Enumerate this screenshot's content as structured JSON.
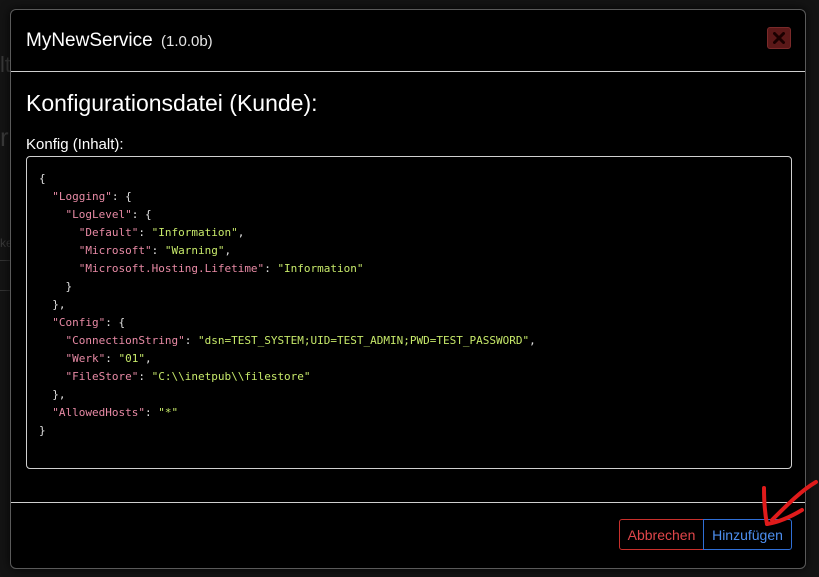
{
  "modal": {
    "title": "MyNewService",
    "version": "(1.0.0b)",
    "heading": "Konfigurationsdatei (Kunde):",
    "config_label": "Konfig (Inhalt):",
    "close_icon": "close-x-icon",
    "config_lines": [
      [
        {
          "t": "p",
          "v": "{"
        }
      ],
      [
        {
          "t": "p",
          "v": "  "
        },
        {
          "t": "k",
          "v": "\"Logging\""
        },
        {
          "t": "p",
          "v": ": {"
        }
      ],
      [
        {
          "t": "p",
          "v": "    "
        },
        {
          "t": "k",
          "v": "\"LogLevel\""
        },
        {
          "t": "p",
          "v": ": {"
        }
      ],
      [
        {
          "t": "p",
          "v": "      "
        },
        {
          "t": "k",
          "v": "\"Default\""
        },
        {
          "t": "p",
          "v": ": "
        },
        {
          "t": "s",
          "v": "\"Information\""
        },
        {
          "t": "p",
          "v": ","
        }
      ],
      [
        {
          "t": "p",
          "v": "      "
        },
        {
          "t": "k",
          "v": "\"Microsoft\""
        },
        {
          "t": "p",
          "v": ": "
        },
        {
          "t": "s",
          "v": "\"Warning\""
        },
        {
          "t": "p",
          "v": ","
        }
      ],
      [
        {
          "t": "p",
          "v": "      "
        },
        {
          "t": "k",
          "v": "\"Microsoft.Hosting.Lifetime\""
        },
        {
          "t": "p",
          "v": ": "
        },
        {
          "t": "s",
          "v": "\"Information\""
        }
      ],
      [
        {
          "t": "p",
          "v": "    }"
        }
      ],
      [
        {
          "t": "p",
          "v": "  },"
        }
      ],
      [
        {
          "t": "p",
          "v": "  "
        },
        {
          "t": "k",
          "v": "\"Config\""
        },
        {
          "t": "p",
          "v": ": {"
        }
      ],
      [
        {
          "t": "p",
          "v": "    "
        },
        {
          "t": "k",
          "v": "\"ConnectionString\""
        },
        {
          "t": "p",
          "v": ": "
        },
        {
          "t": "s",
          "v": "\"dsn=TEST_SYSTEM;UID=TEST_ADMIN;PWD=TEST_PASSWORD\""
        },
        {
          "t": "p",
          "v": ","
        }
      ],
      [
        {
          "t": "p",
          "v": "    "
        },
        {
          "t": "k",
          "v": "\"Werk\""
        },
        {
          "t": "p",
          "v": ": "
        },
        {
          "t": "s",
          "v": "\"01\""
        },
        {
          "t": "p",
          "v": ","
        }
      ],
      [
        {
          "t": "p",
          "v": "    "
        },
        {
          "t": "k",
          "v": "\"FileStore\""
        },
        {
          "t": "p",
          "v": ": "
        },
        {
          "t": "s",
          "v": "\"C:\\\\inetpub\\\\filestore\""
        }
      ],
      [
        {
          "t": "p",
          "v": "  },"
        }
      ],
      [
        {
          "t": "p",
          "v": "  "
        },
        {
          "t": "k",
          "v": "\"AllowedHosts\""
        },
        {
          "t": "p",
          "v": ": "
        },
        {
          "t": "s",
          "v": "\"*\""
        }
      ],
      [
        {
          "t": "p",
          "v": "}"
        }
      ]
    ]
  },
  "footer": {
    "cancel_label": "Abbrechen",
    "add_label": "Hinzufügen"
  },
  "colors": {
    "background": "#000000",
    "json_key": "#e88aa5",
    "json_string": "#c7e96a",
    "cancel": "#e0464a",
    "add": "#4d8ff0",
    "annotation_arrow": "#e01b1b"
  }
}
